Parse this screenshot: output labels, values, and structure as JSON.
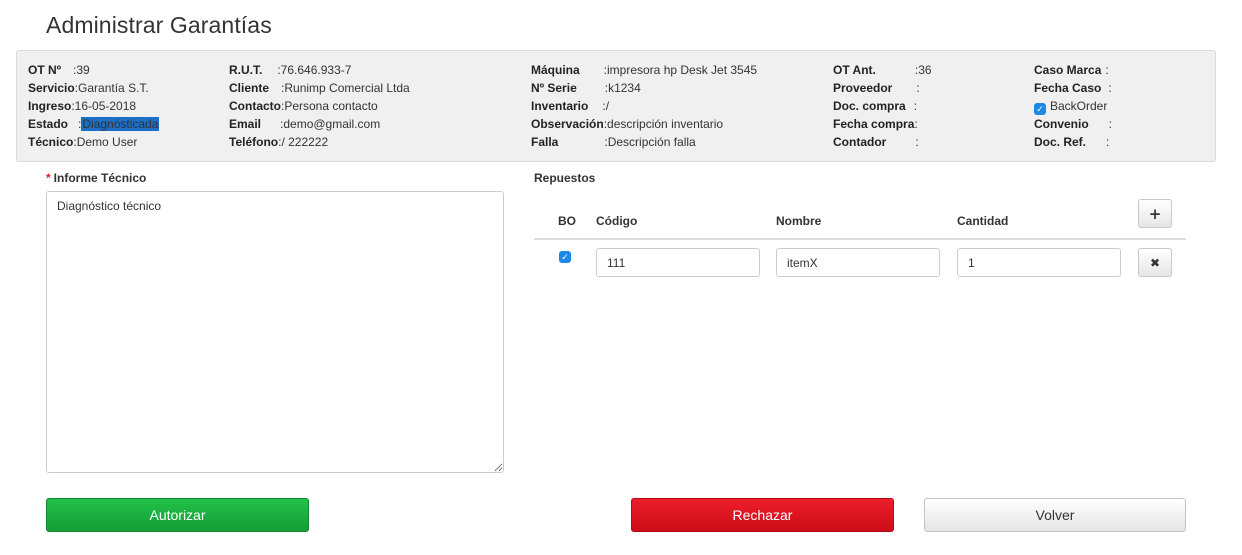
{
  "page": {
    "title": "Administrar Garantías"
  },
  "info": {
    "col1": [
      {
        "label": "OT Nº",
        "value": ":39"
      },
      {
        "label": "Servicio",
        "value": ":Garantía S.T."
      },
      {
        "label": "Ingreso",
        "value": ":16-05-2018"
      },
      {
        "label": "Estado",
        "value_prefix": ":",
        "value": "Diagnósticada"
      },
      {
        "label": "Técnico",
        "value": ":Demo User"
      }
    ],
    "col2": [
      {
        "label": "R.U.T.",
        "value": ":76.646.933-7"
      },
      {
        "label": "Cliente",
        "value": ":Runimp Comercial Ltda"
      },
      {
        "label": "Contacto",
        "value": ":Persona contacto"
      },
      {
        "label": "Email",
        "value": ":demo@gmail.com"
      },
      {
        "label": "Teléfono",
        "value": ":/ 222222"
      }
    ],
    "col3": [
      {
        "label": "Máquina",
        "value": ":impresora hp Desk Jet 3545"
      },
      {
        "label": "Nº Serie",
        "value": ":k1234"
      },
      {
        "label": "Inventario",
        "value": ":/"
      },
      {
        "label": "Observación",
        "value": ":descripción inventario"
      },
      {
        "label": "Falla",
        "value": ":Descripción falla"
      }
    ],
    "col4": [
      {
        "label": "OT Ant.",
        "value": ":36"
      },
      {
        "label": "Proveedor",
        "value": ":"
      },
      {
        "label": "Doc. compra",
        "value": ":"
      },
      {
        "label": "Fecha compra",
        "value": ":"
      },
      {
        "label": "Contador",
        "value": ":"
      }
    ],
    "col5": [
      {
        "label": "Caso Marca",
        "value": ":"
      },
      {
        "label": "Fecha Caso",
        "value": ":"
      },
      {
        "label": "BackOrder",
        "checked": true
      },
      {
        "label": "Convenio",
        "value": ":"
      },
      {
        "label": "Doc. Ref.",
        "value": ":"
      }
    ]
  },
  "informe": {
    "label": "Informe Técnico",
    "required_mark": "*",
    "value": "Diagnóstico técnico"
  },
  "repuestos": {
    "label": "Repuestos",
    "headers": {
      "bo": "BO",
      "codigo": "Código",
      "nombre": "Nombre",
      "cantidad": "Cantidad"
    },
    "add_icon": "+",
    "rows": [
      {
        "bo_checked": true,
        "codigo": "111",
        "nombre": "itemX",
        "cantidad": "1",
        "remove_icon": "✖"
      }
    ]
  },
  "actions": {
    "authorize": "Autorizar",
    "reject": "Rechazar",
    "back": "Volver"
  },
  "colors": {
    "authorize": "#1aaa3f",
    "reject": "#e0141f",
    "highlight": "#1c6fc4",
    "checkbox": "#1e88e5"
  },
  "icons": {
    "add": "plus-icon",
    "remove": "close-icon",
    "check": "check-icon"
  }
}
